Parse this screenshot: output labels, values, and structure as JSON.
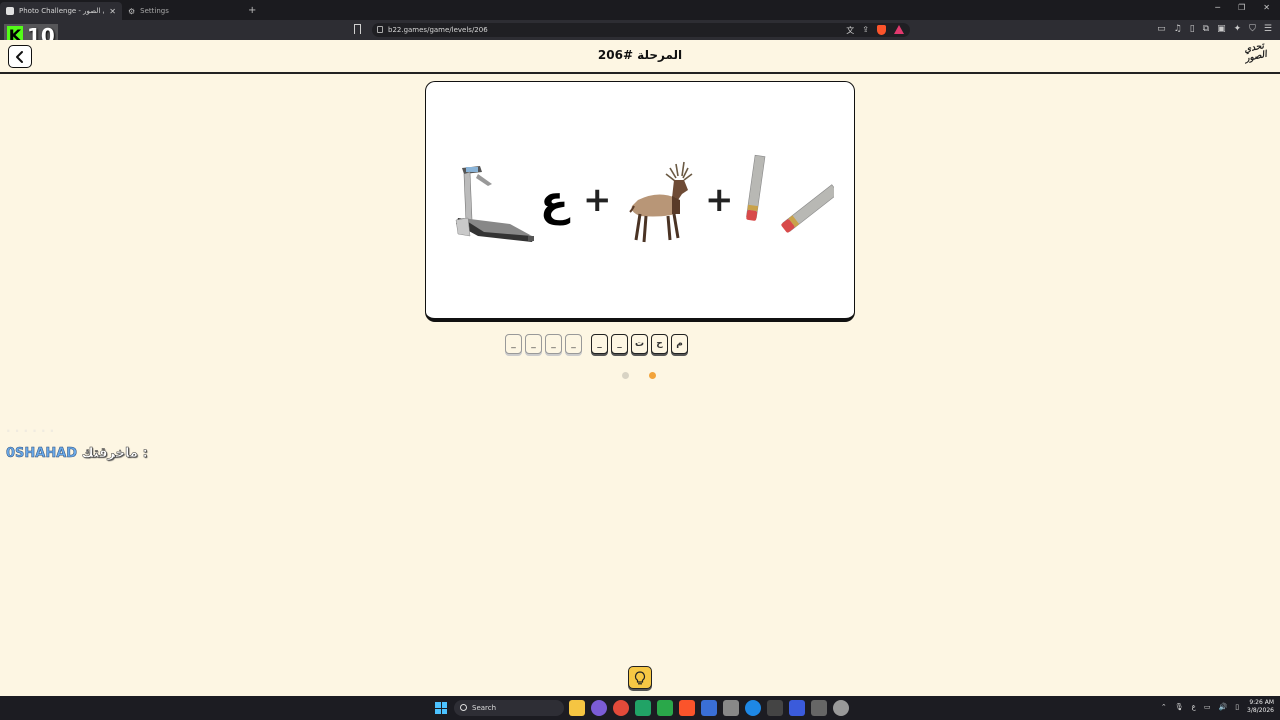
{
  "browser": {
    "tabs": [
      {
        "title": "Photo Challenge - تحدي الصور",
        "active": true
      },
      {
        "title": "Settings",
        "active": false
      }
    ],
    "url": "b22.games/game/levels/206"
  },
  "stream_overlay": {
    "viewer_count": "10"
  },
  "header": {
    "level_title": "المرحلة #206",
    "logo_text": "تحدي الصور"
  },
  "puzzle": {
    "images": [
      "treadmill",
      "arabic-letter",
      "elk",
      "pencil-eraser"
    ],
    "letter": "ع",
    "operator": "+"
  },
  "answer": {
    "word2_slots": [
      "_",
      "_",
      "_",
      "_"
    ],
    "word1_slots": [
      "_",
      "_",
      "ت",
      "ح",
      "م"
    ]
  },
  "dots": {
    "inactive_color": "#d8d3c4",
    "active_color": "#f2a33a"
  },
  "chat": {
    "ghost_text": "· · · · · ·",
    "username": "0SHAHAD",
    "message": "ماخرقتك :"
  },
  "taskbar": {
    "search_placeholder": "Search",
    "time": "9:26 AM",
    "date": "3/8/2026",
    "lang": "ع"
  },
  "colors": {
    "background": "#fdf6e3",
    "accent": "#f6c744",
    "kick_green": "#53fc18"
  }
}
